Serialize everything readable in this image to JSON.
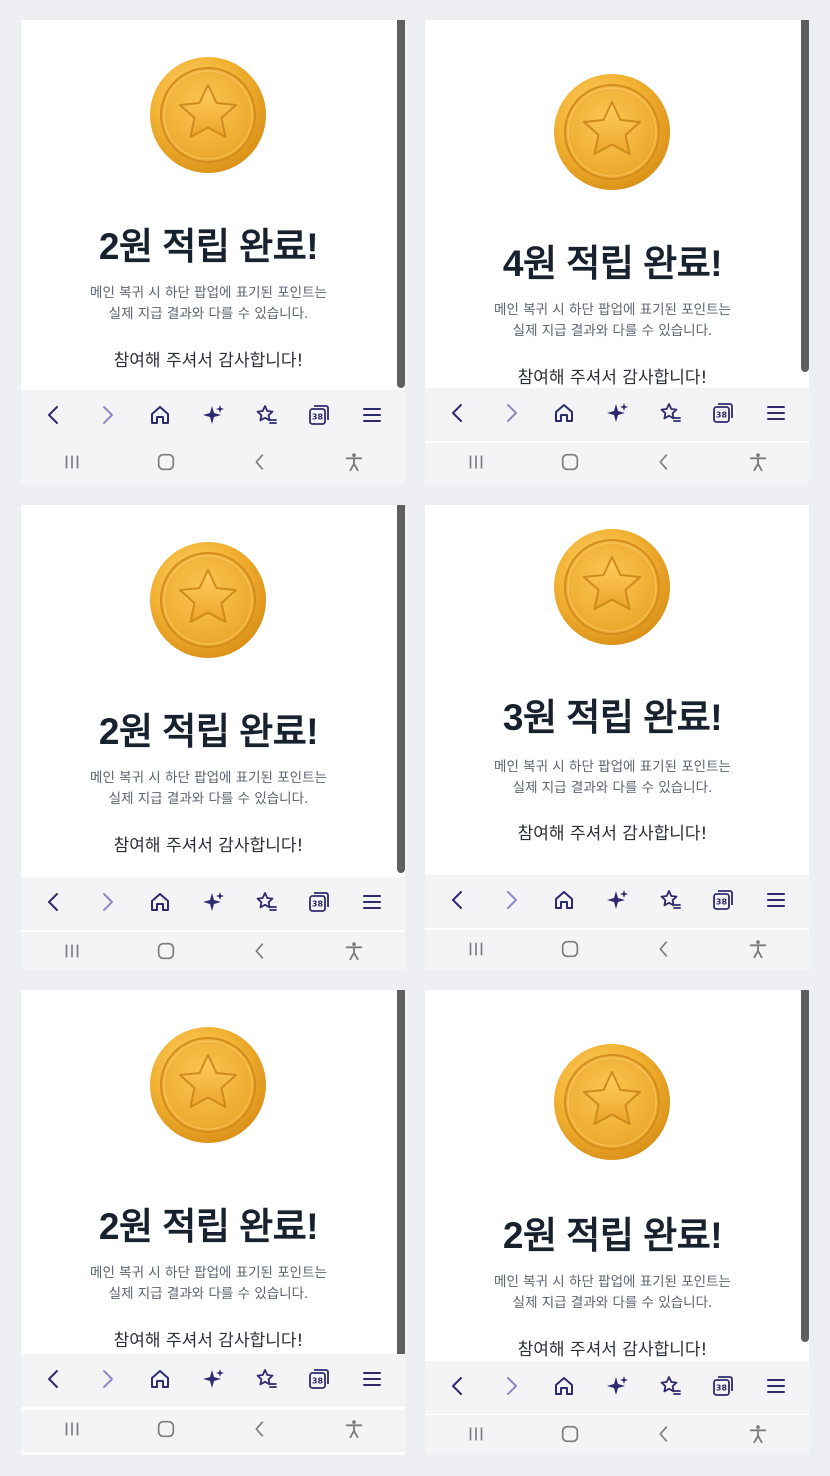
{
  "colors": {
    "headline": "#18222f",
    "notice": "#5b6473",
    "toolbar_icon": "#2e2a6e",
    "toolbar_icon_disabled": "#8c89c7",
    "sysnav_icon": "#7b7b7e",
    "coin_gold": "#f2b233",
    "toolbar_bg": "#f4f4f7"
  },
  "screens": [
    {
      "headline": "2원 적립 완료!",
      "notice_line1": "메인 복귀 시 하단 팝업에 표기된 포인트는",
      "notice_line2": "실제 지급 결과와 다를 수 있습니다.",
      "thanks": "참여해 주셔서 감사합니다!",
      "tab_count": "38"
    },
    {
      "headline": "4원 적립 완료!",
      "notice_line1": "메인 복귀 시 하단 팝업에 표기된 포인트는",
      "notice_line2": "실제 지급 결과와 다를 수 있습니다.",
      "thanks": "참여해 주셔서 감사합니다!",
      "tab_count": "38"
    },
    {
      "headline": "2원 적립 완료!",
      "notice_line1": "메인 복귀 시 하단 팝업에 표기된 포인트는",
      "notice_line2": "실제 지급 결과와 다를 수 있습니다.",
      "thanks": "참여해 주셔서 감사합니다!",
      "tab_count": "38"
    },
    {
      "headline": "3원 적립 완료!",
      "notice_line1": "메인 복귀 시 하단 팝업에 표기된 포인트는",
      "notice_line2": "실제 지급 결과와 다를 수 있습니다.",
      "thanks": "참여해 주셔서 감사합니다!",
      "tab_count": "38"
    },
    {
      "headline": "2원 적립 완료!",
      "notice_line1": "메인 복귀 시 하단 팝업에 표기된 포인트는",
      "notice_line2": "실제 지급 결과와 다를 수 있습니다.",
      "thanks": "참여해 주셔서 감사합니다!",
      "tab_count": "38"
    },
    {
      "headline": "2원 적립 완료!",
      "notice_line1": "메인 복귀 시 하단 팝업에 표기된 포인트는",
      "notice_line2": "실제 지급 결과와 다를 수 있습니다.",
      "thanks": "참여해 주셔서 감사합니다!",
      "tab_count": "38"
    }
  ],
  "toolbar_icons": [
    "back-icon",
    "forward-icon",
    "home-icon",
    "ai-sparkle-icon",
    "bookmarks-icon",
    "tabs-icon",
    "menu-icon"
  ],
  "sysnav_icons": [
    "recent-apps-icon",
    "home-circle-icon",
    "system-back-icon",
    "accessibility-icon"
  ]
}
